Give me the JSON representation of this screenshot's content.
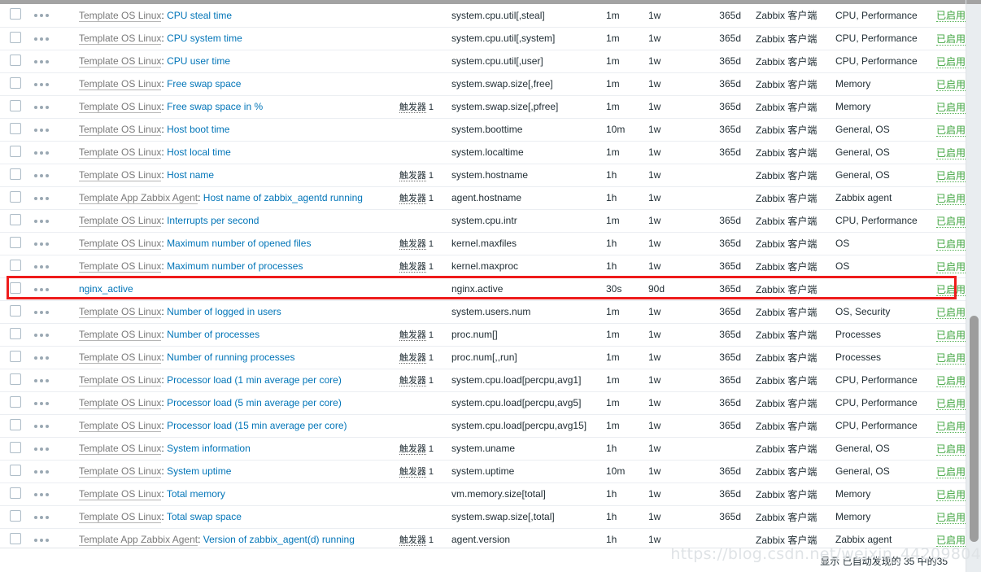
{
  "ui": {
    "template_separator": ": ",
    "trigger_label": "触发器",
    "status_enabled": "已启用",
    "footer_text": "显示 已自动发现的 35 中的35",
    "watermark": "https://blog.csdn.net/weixin_44209804",
    "accent_link_color": "#0275b8",
    "status_color": "#3da33d",
    "highlight_color": "#ee1c1c"
  },
  "rows": [
    {
      "template": "Template OS Linux",
      "name": "CPU steal time",
      "triggers": "",
      "key": "system.cpu.util[,steal]",
      "interval": "1m",
      "history": "1w",
      "trends": "365d",
      "type": "Zabbix 客户端",
      "applications": "CPU, Performance",
      "status": "已启用",
      "highlighted": false
    },
    {
      "template": "Template OS Linux",
      "name": "CPU system time",
      "triggers": "",
      "key": "system.cpu.util[,system]",
      "interval": "1m",
      "history": "1w",
      "trends": "365d",
      "type": "Zabbix 客户端",
      "applications": "CPU, Performance",
      "status": "已启用",
      "highlighted": false
    },
    {
      "template": "Template OS Linux",
      "name": "CPU user time",
      "triggers": "",
      "key": "system.cpu.util[,user]",
      "interval": "1m",
      "history": "1w",
      "trends": "365d",
      "type": "Zabbix 客户端",
      "applications": "CPU, Performance",
      "status": "已启用",
      "highlighted": false
    },
    {
      "template": "Template OS Linux",
      "name": "Free swap space",
      "triggers": "",
      "key": "system.swap.size[,free]",
      "interval": "1m",
      "history": "1w",
      "trends": "365d",
      "type": "Zabbix 客户端",
      "applications": "Memory",
      "status": "已启用",
      "highlighted": false
    },
    {
      "template": "Template OS Linux",
      "name": "Free swap space in %",
      "triggers": "1",
      "key": "system.swap.size[,pfree]",
      "interval": "1m",
      "history": "1w",
      "trends": "365d",
      "type": "Zabbix 客户端",
      "applications": "Memory",
      "status": "已启用",
      "highlighted": false
    },
    {
      "template": "Template OS Linux",
      "name": "Host boot time",
      "triggers": "",
      "key": "system.boottime",
      "interval": "10m",
      "history": "1w",
      "trends": "365d",
      "type": "Zabbix 客户端",
      "applications": "General, OS",
      "status": "已启用",
      "highlighted": false
    },
    {
      "template": "Template OS Linux",
      "name": "Host local time",
      "triggers": "",
      "key": "system.localtime",
      "interval": "1m",
      "history": "1w",
      "trends": "365d",
      "type": "Zabbix 客户端",
      "applications": "General, OS",
      "status": "已启用",
      "highlighted": false
    },
    {
      "template": "Template OS Linux",
      "name": "Host name",
      "triggers": "1",
      "key": "system.hostname",
      "interval": "1h",
      "history": "1w",
      "trends": "",
      "type": "Zabbix 客户端",
      "applications": "General, OS",
      "status": "已启用",
      "highlighted": false
    },
    {
      "template": "Template App Zabbix Agent",
      "name": "Host name of zabbix_agentd running",
      "triggers": "1",
      "key": "agent.hostname",
      "interval": "1h",
      "history": "1w",
      "trends": "",
      "type": "Zabbix 客户端",
      "applications": "Zabbix agent",
      "status": "已启用",
      "highlighted": false
    },
    {
      "template": "Template OS Linux",
      "name": "Interrupts per second",
      "triggers": "",
      "key": "system.cpu.intr",
      "interval": "1m",
      "history": "1w",
      "trends": "365d",
      "type": "Zabbix 客户端",
      "applications": "CPU, Performance",
      "status": "已启用",
      "highlighted": false
    },
    {
      "template": "Template OS Linux",
      "name": "Maximum number of opened files",
      "triggers": "1",
      "key": "kernel.maxfiles",
      "interval": "1h",
      "history": "1w",
      "trends": "365d",
      "type": "Zabbix 客户端",
      "applications": "OS",
      "status": "已启用",
      "highlighted": false
    },
    {
      "template": "Template OS Linux",
      "name": "Maximum number of processes",
      "triggers": "1",
      "key": "kernel.maxproc",
      "interval": "1h",
      "history": "1w",
      "trends": "365d",
      "type": "Zabbix 客户端",
      "applications": "OS",
      "status": "已启用",
      "highlighted": false
    },
    {
      "template": "",
      "name": "nginx_active",
      "triggers": "",
      "key": "nginx.active",
      "interval": "30s",
      "history": "90d",
      "trends": "365d",
      "type": "Zabbix 客户端",
      "applications": "",
      "status": "已启用",
      "highlighted": true
    },
    {
      "template": "Template OS Linux",
      "name": "Number of logged in users",
      "triggers": "",
      "key": "system.users.num",
      "interval": "1m",
      "history": "1w",
      "trends": "365d",
      "type": "Zabbix 客户端",
      "applications": "OS, Security",
      "status": "已启用",
      "highlighted": false
    },
    {
      "template": "Template OS Linux",
      "name": "Number of processes",
      "triggers": "1",
      "key": "proc.num[]",
      "interval": "1m",
      "history": "1w",
      "trends": "365d",
      "type": "Zabbix 客户端",
      "applications": "Processes",
      "status": "已启用",
      "highlighted": false
    },
    {
      "template": "Template OS Linux",
      "name": "Number of running processes",
      "triggers": "1",
      "key": "proc.num[,,run]",
      "interval": "1m",
      "history": "1w",
      "trends": "365d",
      "type": "Zabbix 客户端",
      "applications": "Processes",
      "status": "已启用",
      "highlighted": false
    },
    {
      "template": "Template OS Linux",
      "name": "Processor load (1 min average per core)",
      "triggers": "1",
      "key": "system.cpu.load[percpu,avg1]",
      "interval": "1m",
      "history": "1w",
      "trends": "365d",
      "type": "Zabbix 客户端",
      "applications": "CPU, Performance",
      "status": "已启用",
      "highlighted": false
    },
    {
      "template": "Template OS Linux",
      "name": "Processor load (5 min average per core)",
      "triggers": "",
      "key": "system.cpu.load[percpu,avg5]",
      "interval": "1m",
      "history": "1w",
      "trends": "365d",
      "type": "Zabbix 客户端",
      "applications": "CPU, Performance",
      "status": "已启用",
      "highlighted": false
    },
    {
      "template": "Template OS Linux",
      "name": "Processor load (15 min average per core)",
      "triggers": "",
      "key": "system.cpu.load[percpu,avg15]",
      "interval": "1m",
      "history": "1w",
      "trends": "365d",
      "type": "Zabbix 客户端",
      "applications": "CPU, Performance",
      "status": "已启用",
      "highlighted": false
    },
    {
      "template": "Template OS Linux",
      "name": "System information",
      "triggers": "1",
      "key": "system.uname",
      "interval": "1h",
      "history": "1w",
      "trends": "",
      "type": "Zabbix 客户端",
      "applications": "General, OS",
      "status": "已启用",
      "highlighted": false
    },
    {
      "template": "Template OS Linux",
      "name": "System uptime",
      "triggers": "1",
      "key": "system.uptime",
      "interval": "10m",
      "history": "1w",
      "trends": "365d",
      "type": "Zabbix 客户端",
      "applications": "General, OS",
      "status": "已启用",
      "highlighted": false
    },
    {
      "template": "Template OS Linux",
      "name": "Total memory",
      "triggers": "",
      "key": "vm.memory.size[total]",
      "interval": "1h",
      "history": "1w",
      "trends": "365d",
      "type": "Zabbix 客户端",
      "applications": "Memory",
      "status": "已启用",
      "highlighted": false
    },
    {
      "template": "Template OS Linux",
      "name": "Total swap space",
      "triggers": "",
      "key": "system.swap.size[,total]",
      "interval": "1h",
      "history": "1w",
      "trends": "365d",
      "type": "Zabbix 客户端",
      "applications": "Memory",
      "status": "已启用",
      "highlighted": false
    },
    {
      "template": "Template App Zabbix Agent",
      "name": "Version of zabbix_agent(d) running",
      "triggers": "1",
      "key": "agent.version",
      "interval": "1h",
      "history": "1w",
      "trends": "",
      "type": "Zabbix 客户端",
      "applications": "Zabbix agent",
      "status": "已启用",
      "highlighted": false
    }
  ]
}
